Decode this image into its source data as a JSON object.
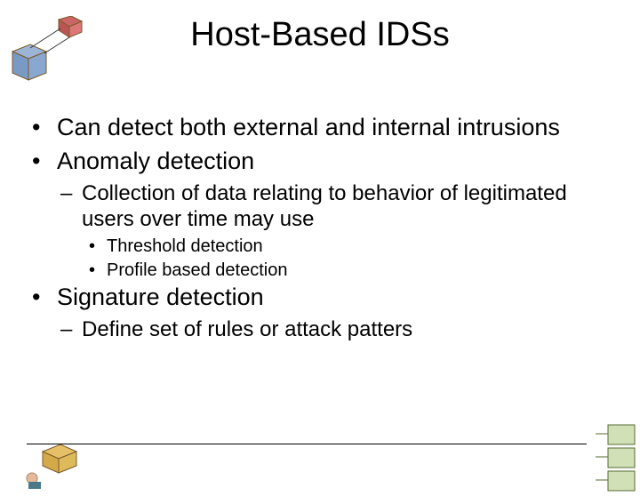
{
  "title": "Host-Based IDSs",
  "bullets": [
    {
      "text": "Can detect both external and internal intrusions"
    },
    {
      "text": "Anomaly detection",
      "children": [
        {
          "text": "Collection of data relating to behavior of legitimated users over time may use",
          "children": [
            {
              "text": "Threshold detection"
            },
            {
              "text": "Profile based detection"
            }
          ]
        }
      ]
    },
    {
      "text": "Signature detection",
      "children": [
        {
          "text": "Define set of rules or attack patters"
        }
      ]
    }
  ]
}
